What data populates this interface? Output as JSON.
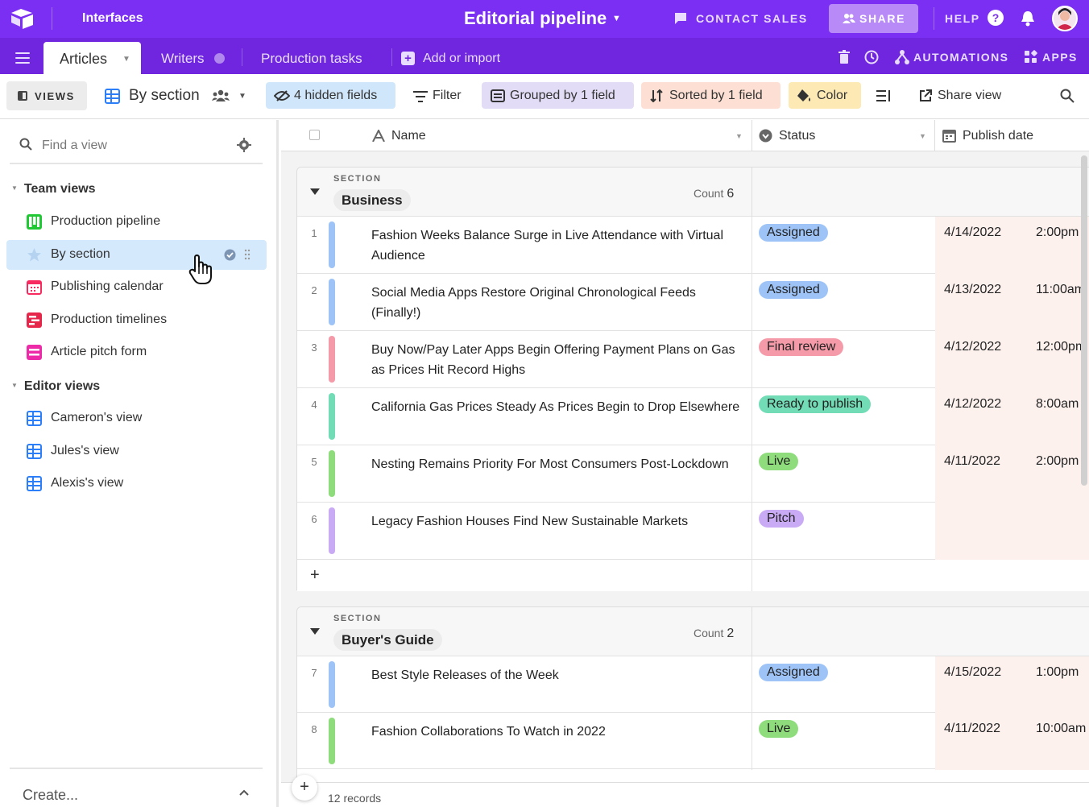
{
  "topbar": {
    "interfaces_label": "Interfaces",
    "base_title": "Editorial pipeline",
    "contact_sales": "CONTACT SALES",
    "share": "SHARE",
    "help": "HELP",
    "help_icon": "?",
    "colors": {
      "brand": "#7b2ff2",
      "tabbar": "#6f26de"
    }
  },
  "tabs": {
    "active": "Articles",
    "items": [
      "Writers",
      "Production tasks"
    ],
    "add_import": "Add or import",
    "automations": "AUTOMATIONS",
    "apps": "APPS"
  },
  "toolbar": {
    "views": "VIEWS",
    "view_name": "By section",
    "hidden_fields": "4 hidden fields",
    "filter": "Filter",
    "grouped": "Grouped by 1 field",
    "sorted": "Sorted by 1 field",
    "color": "Color",
    "share_view": "Share view"
  },
  "sidebar": {
    "find_placeholder": "Find a view",
    "sections": [
      {
        "title": "Team views",
        "items": [
          {
            "label": "Production pipeline",
            "icon": "kanban-icon"
          },
          {
            "label": "By section",
            "icon": "star-icon",
            "selected": true
          },
          {
            "label": "Publishing calendar",
            "icon": "calendar-icon"
          },
          {
            "label": "Production timelines",
            "icon": "timeline-icon"
          },
          {
            "label": "Article pitch form",
            "icon": "form-icon"
          }
        ]
      },
      {
        "title": "Editor views",
        "items": [
          {
            "label": "Cameron's view",
            "icon": "grid-icon"
          },
          {
            "label": "Jules's view",
            "icon": "grid-icon"
          },
          {
            "label": "Alexis's view",
            "icon": "grid-icon"
          }
        ]
      }
    ],
    "create": "Create..."
  },
  "grid": {
    "columns": {
      "name": "Name",
      "status": "Status",
      "publish_date": "Publish date"
    },
    "section_label": "SECTION",
    "count_label": "Count",
    "groups": [
      {
        "name": "Business",
        "count": "6",
        "rows": [
          {
            "num": "1",
            "color": "#9ec4f7",
            "name": "Fashion Weeks Balance Surge in Live Attendance with Virtual Audience",
            "status": "Assigned",
            "status_color": "#9ec4f7",
            "date": "4/14/2022",
            "time": "2:00pm"
          },
          {
            "num": "2",
            "color": "#9ec4f7",
            "name": "Social Media Apps Restore Original Chronological Feeds (Finally!)",
            "status": "Assigned",
            "status_color": "#9ec4f7",
            "date": "4/13/2022",
            "time": "11:00am"
          },
          {
            "num": "3",
            "color": "#f59aa8",
            "name": "Buy Now/Pay Later Apps Begin Offering Payment Plans on Gas as Prices Hit Record Highs",
            "status": "Final review",
            "status_color": "#f59aa8",
            "date": "4/12/2022",
            "time": "12:00pm"
          },
          {
            "num": "4",
            "color": "#72dcb6",
            "name": "California Gas Prices Steady As Prices Begin to Drop Elsewhere",
            "status": "Ready to publish",
            "status_color": "#72dcb6",
            "date": "4/12/2022",
            "time": "8:00am"
          },
          {
            "num": "5",
            "color": "#8fdc7c",
            "name": "Nesting Remains Priority For Most Consumers Post-Lockdown",
            "status": "Live",
            "status_color": "#8fdc7c",
            "date": "4/11/2022",
            "time": "2:00pm"
          },
          {
            "num": "6",
            "color": "#c9aaf5",
            "name": "Legacy Fashion Houses Find New Sustainable Markets",
            "status": "Pitch",
            "status_color": "#c9aaf5",
            "date": "",
            "time": ""
          }
        ]
      },
      {
        "name": "Buyer's Guide",
        "count": "2",
        "rows": [
          {
            "num": "7",
            "color": "#9ec4f7",
            "name": "Best Style Releases of the Week",
            "status": "Assigned",
            "status_color": "#9ec4f7",
            "date": "4/15/2022",
            "time": "1:00pm"
          },
          {
            "num": "8",
            "color": "#8fdc7c",
            "name": "Fashion Collaborations To Watch in 2022",
            "status": "Live",
            "status_color": "#8fdc7c",
            "date": "4/11/2022",
            "time": "10:00am"
          }
        ]
      }
    ],
    "add_row": "+",
    "records": "12 records"
  }
}
